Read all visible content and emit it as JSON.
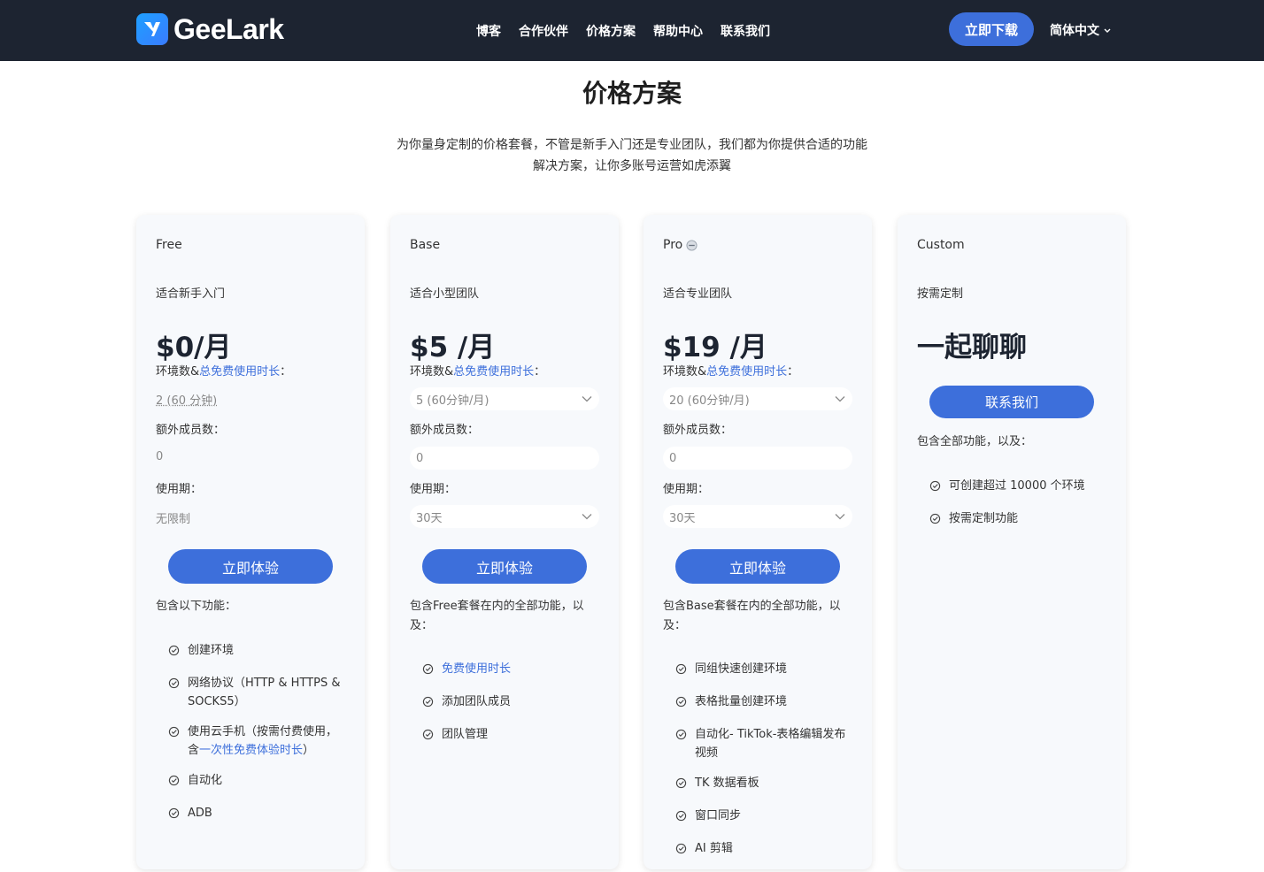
{
  "header": {
    "logo_text": "GeeLark",
    "nav": [
      "博客",
      "合作伙伴",
      "价格方案",
      "帮助中心",
      "联系我们"
    ],
    "download_label": "立即下载",
    "language": "简体中文"
  },
  "main": {
    "title": "价格方案",
    "subtitle_line1": "为你量身定制的价格套餐，不管是新手入门还是专业团队，我们都为你提供合适的功能",
    "subtitle_line2": "解决方案，让你多账号运营如虎添翼"
  },
  "cards": {
    "free": {
      "name": "Free",
      "desc": "适合新手入门",
      "price": "$0/月",
      "env_label_a": "环境数&",
      "env_label_link": "总免费使用时长",
      "env_label_b": "：",
      "env_value": "2 (60 分钟)",
      "members_label": "额外成员数：",
      "members_value": "0",
      "period_label": "使用期：",
      "period_value": "无限制",
      "try_label": "立即体验",
      "includes": "包含以下功能：",
      "features": [
        "创建环境",
        "网络协议（HTTP & HTTPS & SOCKS5）",
        "自动化",
        "ADB"
      ],
      "feature_cloud_a": "使用云手机（按需付费使用，含",
      "feature_cloud_link": "一次性免费体验时长",
      "feature_cloud_b": "）"
    },
    "base": {
      "name": "Base",
      "desc": "适合小型团队",
      "price": "$5 /月",
      "env_label_a": "环境数&",
      "env_label_link": "总免费使用时长",
      "env_label_b": "：",
      "env_value": "5 (60分钟/月)",
      "members_label": "额外成员数：",
      "members_value": "0",
      "period_label": "使用期：",
      "period_value": "30天",
      "try_label": "立即体验",
      "includes": "包含Free套餐在内的全部功能，以及：",
      "feature_link": "免费使用时长",
      "features": [
        "添加团队成员",
        "团队管理"
      ]
    },
    "pro": {
      "name": "Pro",
      "desc": "适合专业团队",
      "price": "$19 /月",
      "env_label_a": "环境数&",
      "env_label_link": "总免费使用时长",
      "env_label_b": "：",
      "env_value": "20 (60分钟/月)",
      "members_label": "额外成员数：",
      "members_value": "0",
      "period_label": "使用期：",
      "period_value": "30天",
      "try_label": "立即体验",
      "includes": "包含Base套餐在内的全部功能，以及：",
      "features": [
        "同组快速创建环境",
        "表格批量创建环境",
        "自动化- TikTok-表格编辑发布视频",
        "TK 数据看板",
        "窗口同步",
        "AI 剪辑"
      ]
    },
    "custom": {
      "name": "Custom",
      "desc": "按需定制",
      "title": "一起聊聊",
      "contact_label": "联系我们",
      "includes": "包含全部功能，以及：",
      "features": [
        "可创建超过 10000 个环境",
        "按需定制功能"
      ]
    }
  },
  "colors": {
    "header_bg": "#1d2431",
    "accent": "#3d6fdb",
    "card_bg": "#f7f9fc"
  }
}
